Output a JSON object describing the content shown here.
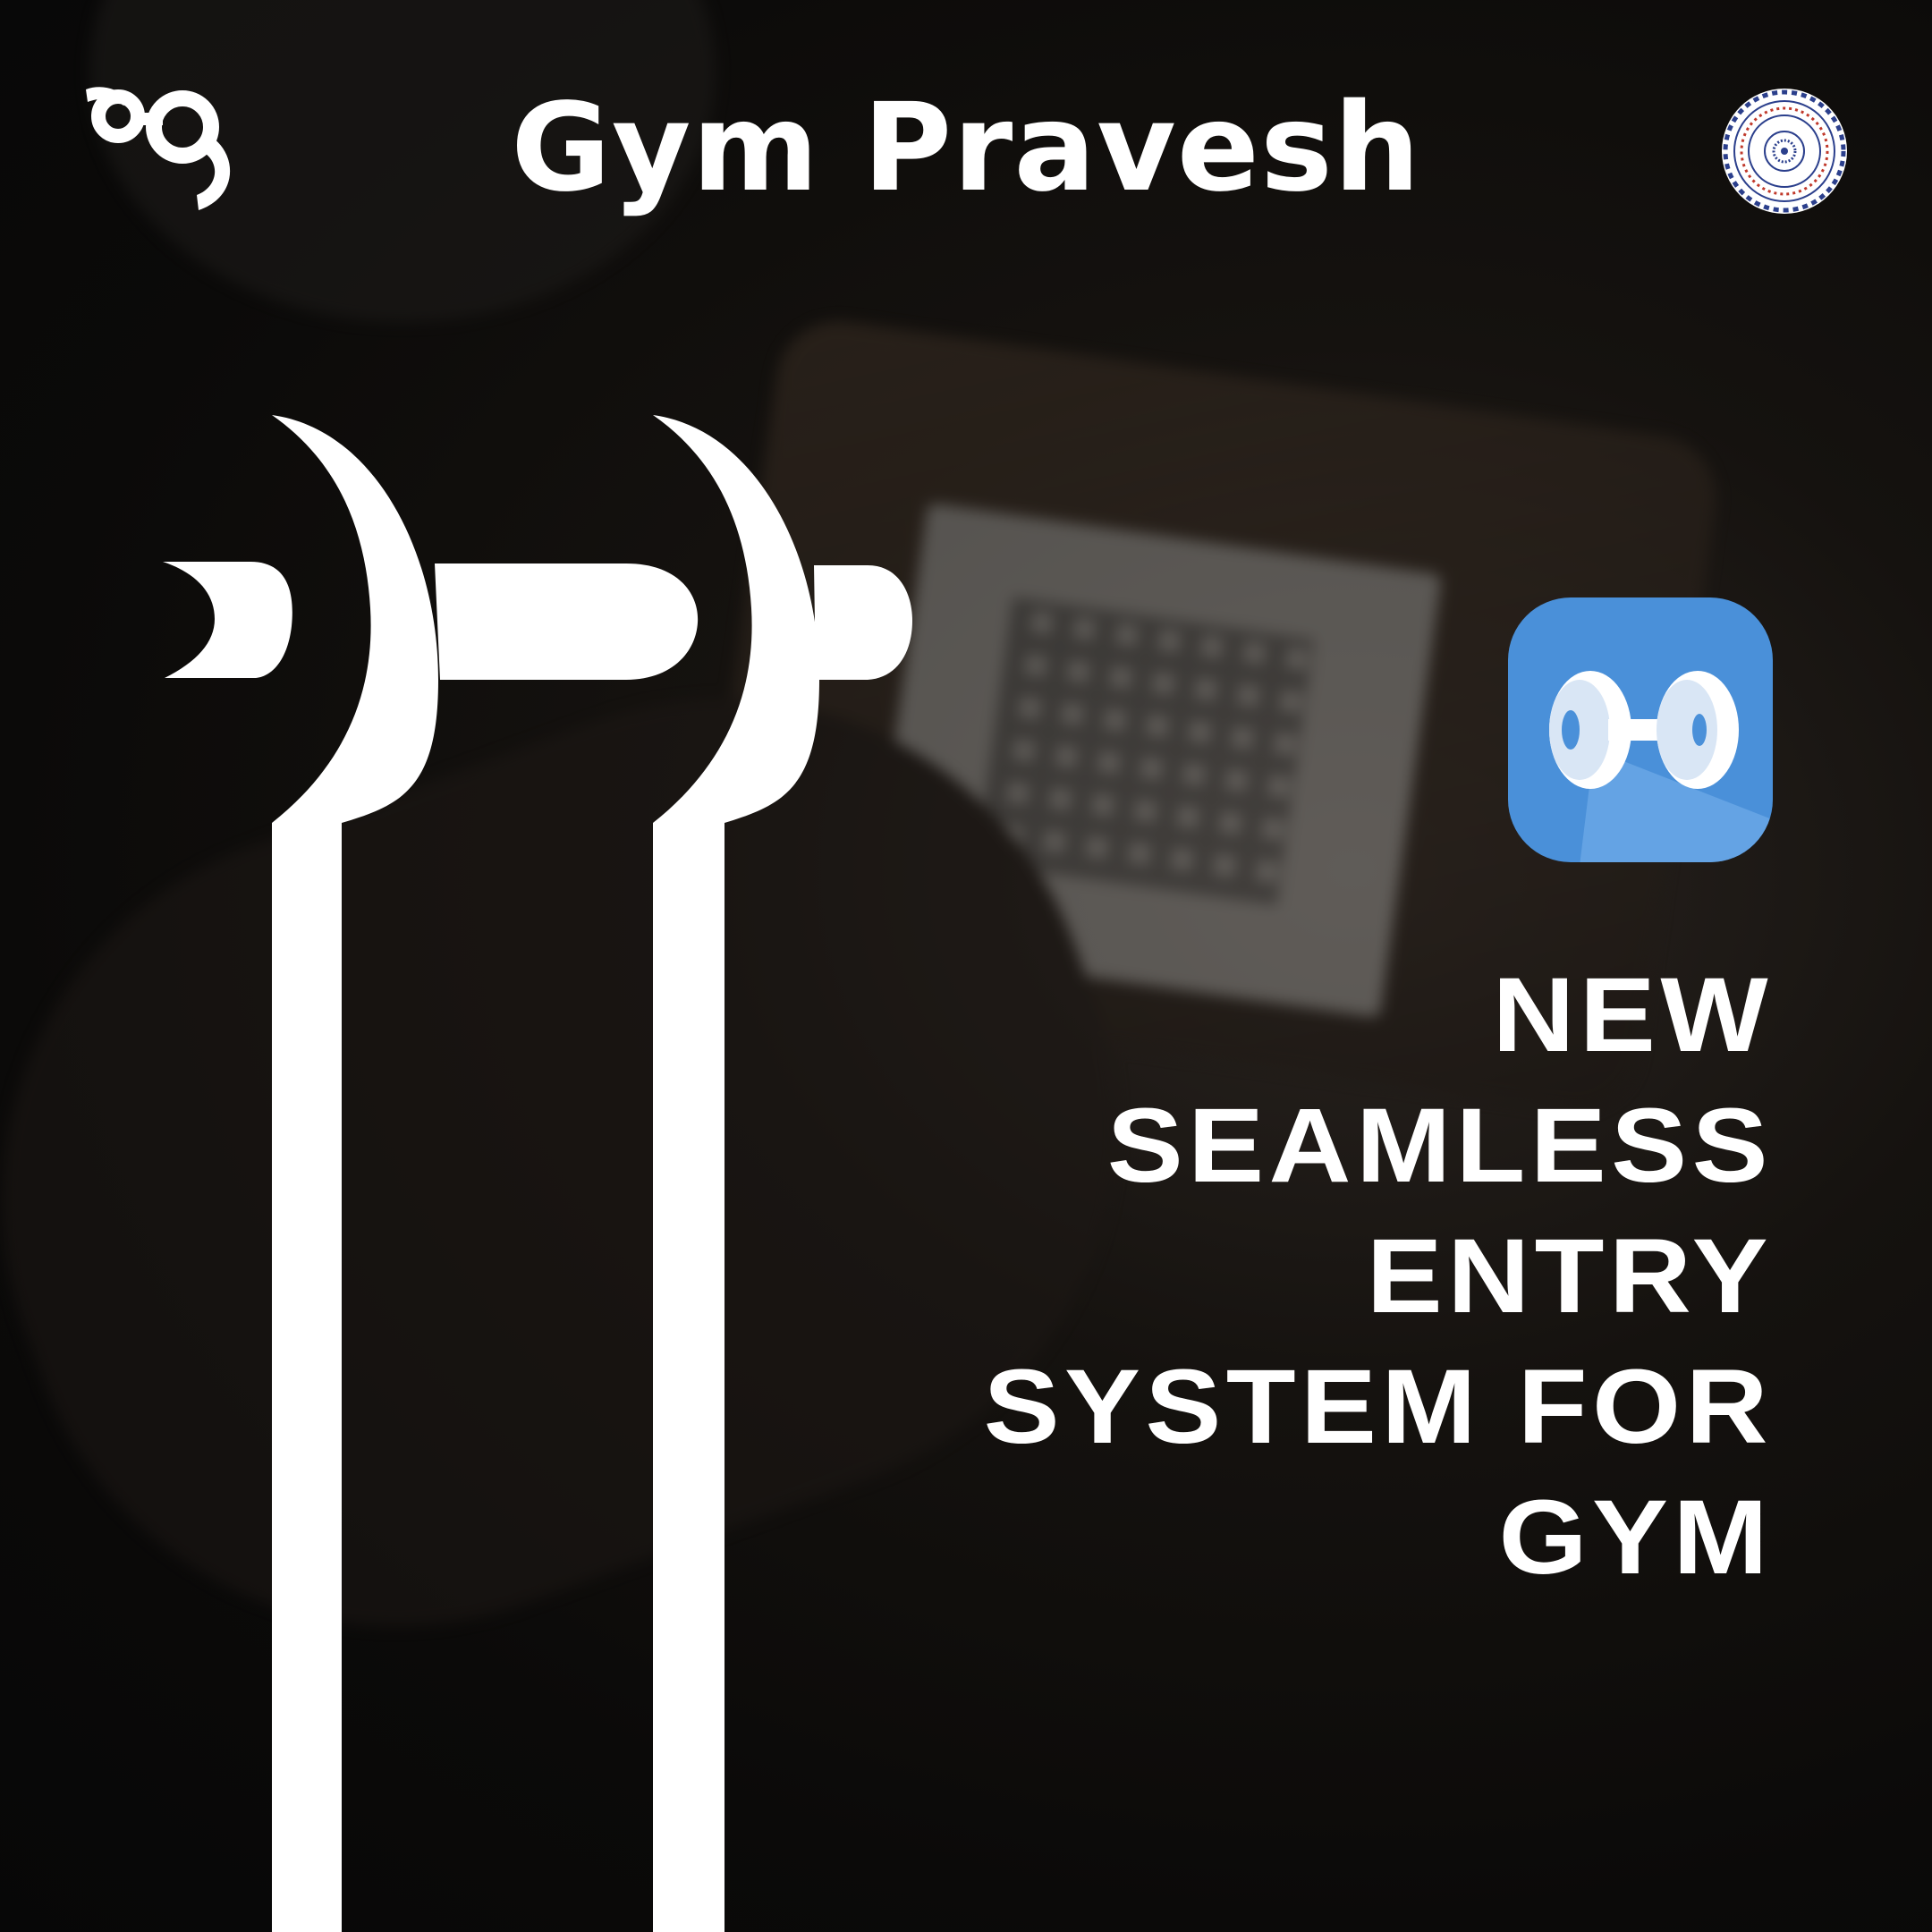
{
  "header": {
    "title": "Gym Pravesh",
    "left_logo_icon": "club-logo-icon",
    "right_emblem_icon": "institute-emblem-icon"
  },
  "illustration": {
    "icon": "turnstile-glyph-icon"
  },
  "app_icon": {
    "icon": "dumbbell-app-icon",
    "background_color": "#4a90d9"
  },
  "headline": {
    "lines": [
      "NEW",
      "SEAMLESS",
      "ENTRY",
      "SYSTEM FOR",
      "GYM"
    ]
  },
  "colors": {
    "text": "#ffffff",
    "background": "#0a0a0a",
    "accent": "#4a90d9"
  }
}
